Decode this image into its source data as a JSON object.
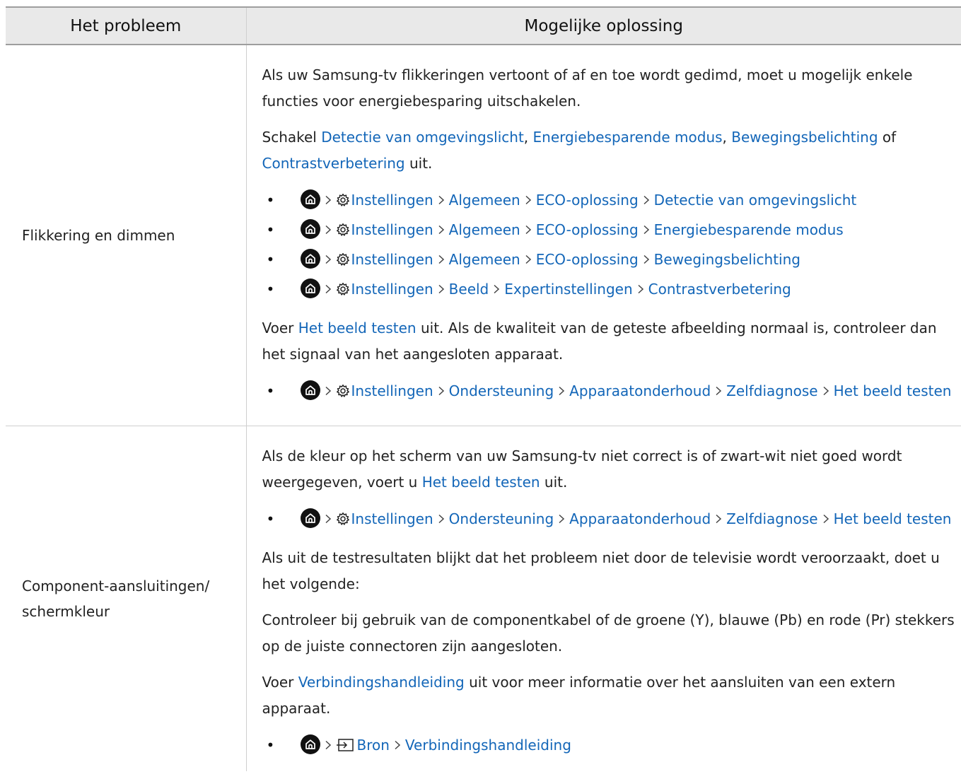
{
  "header": {
    "col1": "Het probleem",
    "col2": "Mogelijke oplossing"
  },
  "rows": [
    {
      "problem": "Flikkering en dimmen",
      "p1": "Als uw Samsung-tv flikkeringen vertoont of af en toe wordt gedimd, moet u mogelijk enkele functies voor energiebesparing uitschakelen.",
      "p2": {
        "pre": "Schakel ",
        "l1": "Detectie van omgevingslicht",
        "c1": ", ",
        "l2": "Energiebesparende modus",
        "c2": ", ",
        "l3": "Bewegingsbelichting",
        "c3": " of ",
        "l4": "Contrastverbetering",
        "post": " uit."
      },
      "paths1": [
        [
          "Instellingen",
          "Algemeen",
          "ECO-oplossing",
          "Detectie van omgevingslicht"
        ],
        [
          "Instellingen",
          "Algemeen",
          "ECO-oplossing",
          "Energiebesparende modus"
        ],
        [
          "Instellingen",
          "Algemeen",
          "ECO-oplossing",
          "Bewegingsbelichting"
        ],
        [
          "Instellingen",
          "Beeld",
          "Expertinstellingen",
          "Contrastverbetering"
        ]
      ],
      "p3": {
        "pre": "Voer ",
        "l1": "Het beeld testen",
        "post": " uit. Als de kwaliteit van de geteste afbeelding normaal is, controleer dan het signaal van het aangesloten apparaat."
      },
      "paths2": [
        [
          "Instellingen",
          "Ondersteuning",
          "Apparaatonderhoud",
          "Zelfdiagnose",
          "Het beeld testen"
        ]
      ]
    },
    {
      "problem": "Component-aansluitingen/ schermkleur",
      "p1": {
        "pre": "Als de kleur op het scherm van uw Samsung-tv niet correct is of zwart-wit niet goed wordt weergegeven, voert u ",
        "l1": "Het beeld testen",
        "post": " uit."
      },
      "paths1": [
        [
          "Instellingen",
          "Ondersteuning",
          "Apparaatonderhoud",
          "Zelfdiagnose",
          "Het beeld testen"
        ]
      ],
      "p2": "Als uit de testresultaten blijkt dat het probleem niet door de televisie wordt veroorzaakt, doet u het volgende:",
      "p3": "Controleer bij gebruik van de componentkabel of de groene (Y), blauwe (Pb) en rode (Pr) stekkers op de juiste connectoren zijn aangesloten.",
      "p4": {
        "pre": "Voer ",
        "l1": "Verbindingshandleiding",
        "post": " uit voor meer informatie over het aansluiten van een extern apparaat."
      },
      "paths2": [
        [
          "Bron",
          "Verbindingshandleiding"
        ]
      ]
    }
  ],
  "icons": {
    "home": "home-icon",
    "settings": "gear-icon",
    "source": "source-icon",
    "separator": "chevron-right-icon"
  },
  "colors": {
    "link": "#1366b8",
    "header_bg": "#e9e9e9"
  }
}
